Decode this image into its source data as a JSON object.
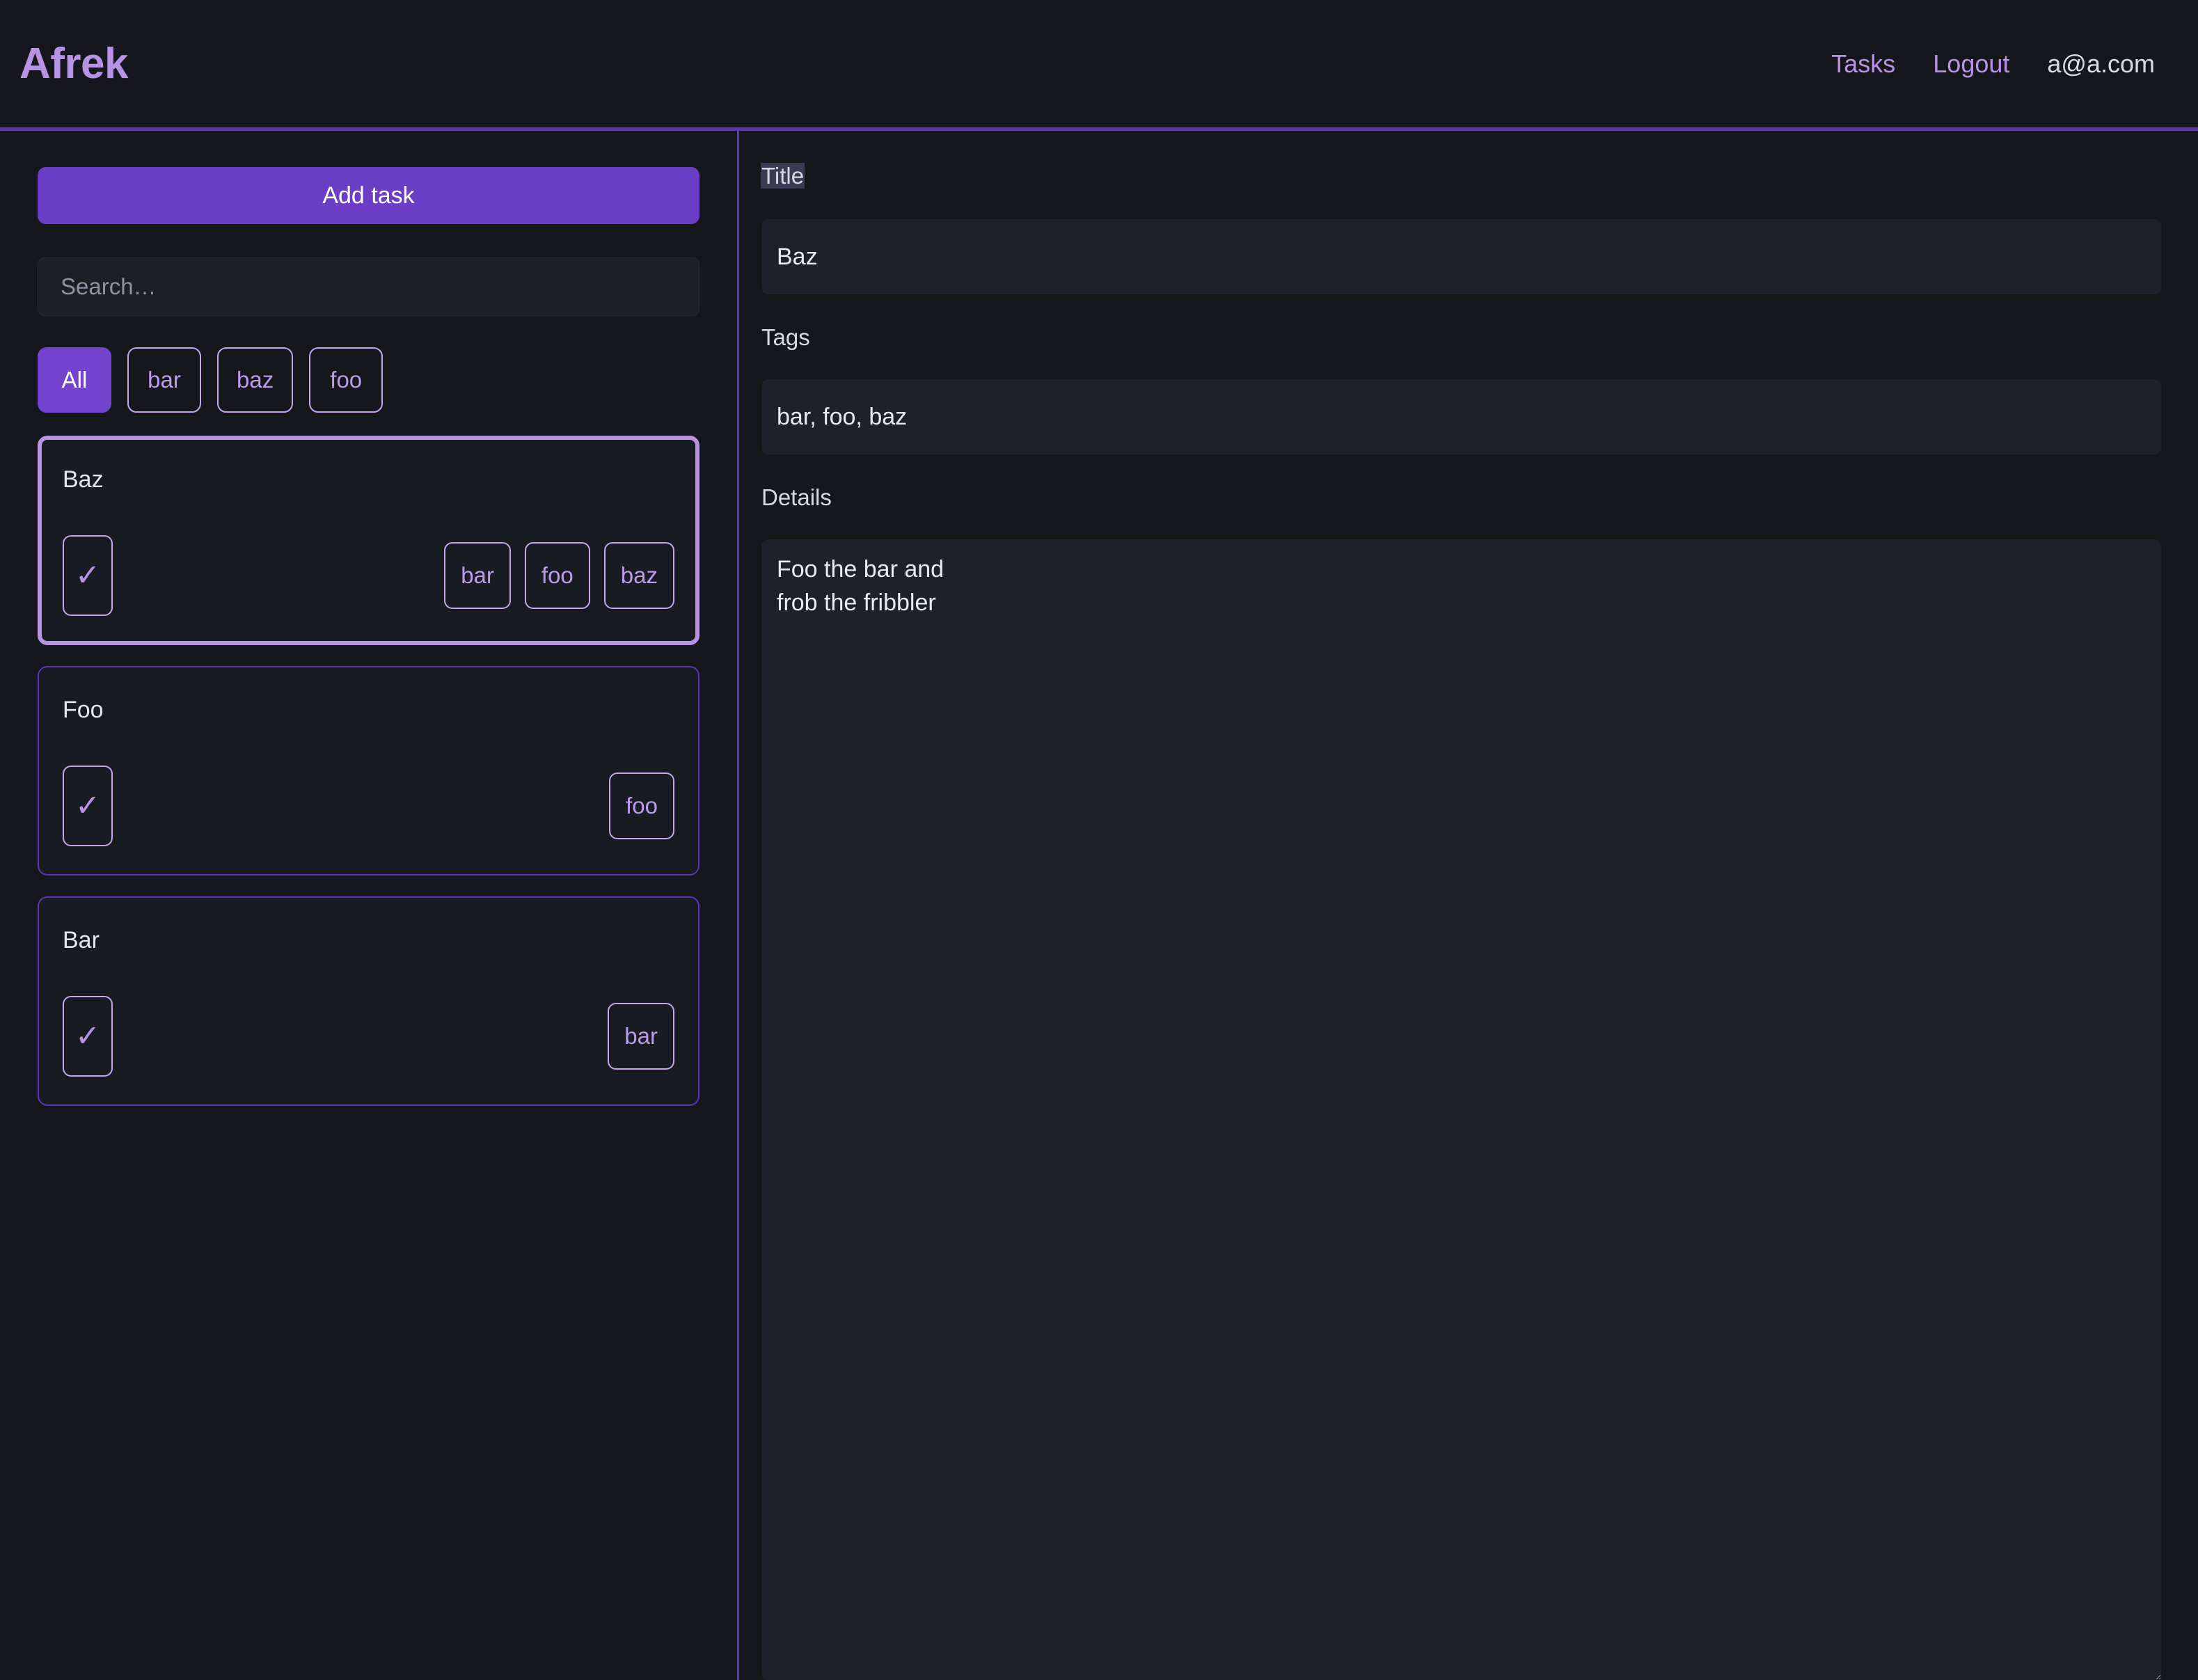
{
  "header": {
    "brand": "Afrek",
    "nav": [
      {
        "label": "Tasks",
        "name": "nav-link-tasks"
      },
      {
        "label": "Logout",
        "name": "nav-link-logout"
      }
    ],
    "user_email": "a@a.com"
  },
  "sidebar": {
    "add_task_label": "Add task",
    "search_placeholder": "Search…",
    "search_value": "",
    "filters": [
      {
        "label": "All",
        "active": true
      },
      {
        "label": "bar",
        "active": false
      },
      {
        "label": "baz",
        "active": false
      },
      {
        "label": "foo",
        "active": false
      }
    ],
    "tasks": [
      {
        "title": "Baz",
        "selected": true,
        "checkbox_glyph": "✓",
        "checked": true,
        "tags": [
          "bar",
          "foo",
          "baz"
        ]
      },
      {
        "title": "Foo",
        "selected": false,
        "checkbox_glyph": "✓",
        "checked": true,
        "tags": [
          "foo"
        ]
      },
      {
        "title": "Bar",
        "selected": false,
        "checkbox_glyph": "✓",
        "checked": true,
        "tags": [
          "bar"
        ]
      }
    ]
  },
  "detail": {
    "title_label": "Title",
    "title_value": "Baz",
    "tags_label": "Tags",
    "tags_value": "bar, foo, baz",
    "details_label": "Details",
    "details_value": "Foo the bar and\nfrob the fribbler"
  },
  "colors": {
    "page_bg": "#15171d",
    "panel_bg": "#191b23",
    "input_bg": "#1e202b",
    "accent": "#6c3ec5",
    "accent_border": "#5b35b8",
    "accent_light": "#b793e6",
    "text": "#e3e6ec",
    "muted": "#8e93a3",
    "selection_bg": "#3a3a52"
  }
}
